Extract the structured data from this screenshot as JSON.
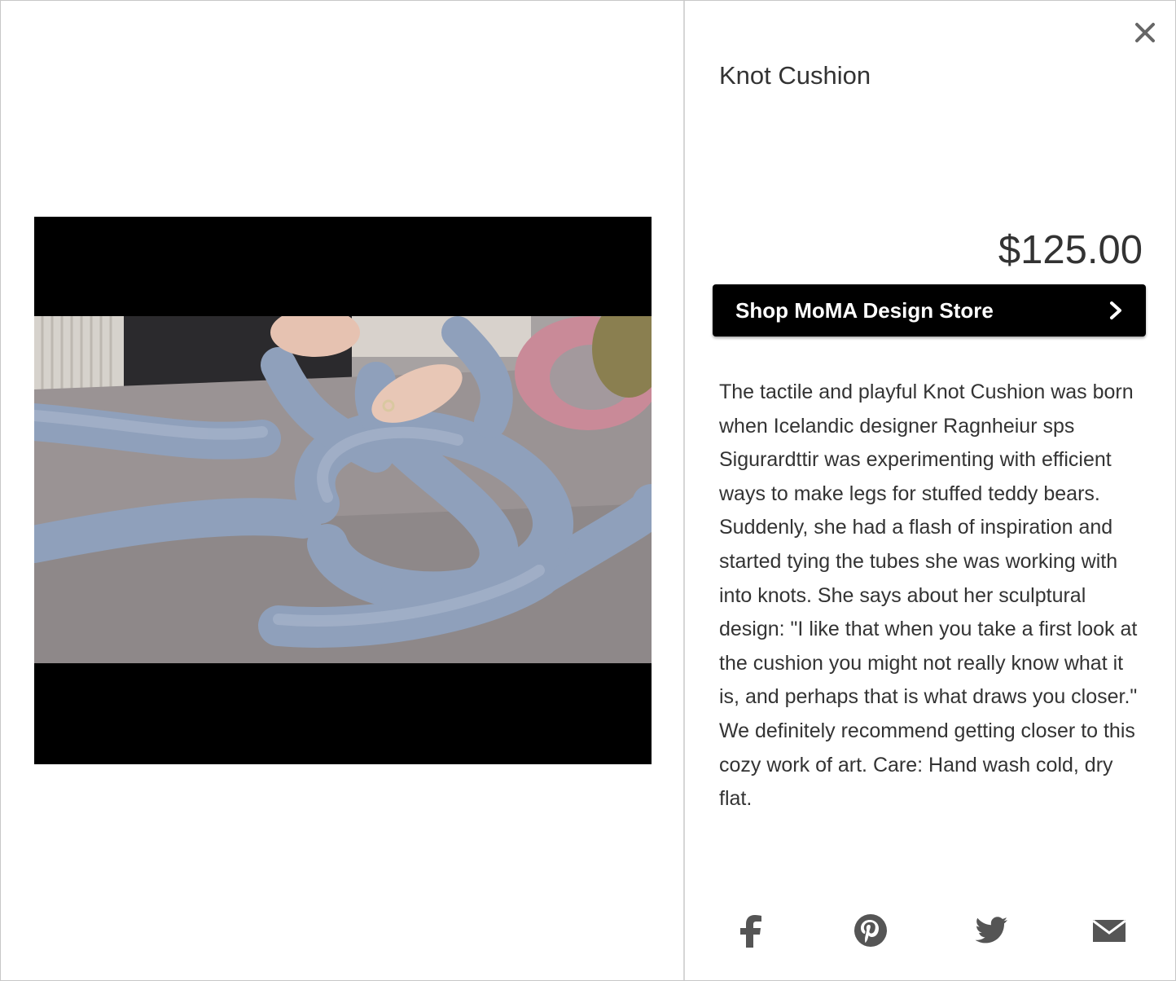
{
  "product": {
    "title": "Knot Cushion",
    "price": "$125.00",
    "description": "The tactile and playful Knot Cushion was born when Icelandic designer Ragnheiur sps Sigurardttir was experimenting with efficient ways to make legs for stuffed teddy bears. Suddenly, she had a flash of inspiration and started tying the tubes she was working with into knots. She says about her sculptural design: \"I like that when you take a first look at the cushion you might not really know what it is, and perhaps that is what draws you closer.\" We definitely recommend getting closer to this cozy work of art. Care: Hand wash cold, dry flat."
  },
  "shop_button": {
    "label": "Shop MoMA Design Store",
    "icon": "chevron-right-icon"
  },
  "close_button": {
    "icon": "close-icon"
  },
  "share": [
    {
      "name": "facebook",
      "icon": "facebook-icon"
    },
    {
      "name": "pinterest",
      "icon": "pinterest-icon"
    },
    {
      "name": "twitter",
      "icon": "twitter-icon"
    },
    {
      "name": "email",
      "icon": "mail-icon"
    }
  ],
  "colors": {
    "text": "#333333",
    "button_bg": "#000000",
    "button_text": "#ffffff",
    "icon": "#555555",
    "divider": "#d6d6d6"
  }
}
